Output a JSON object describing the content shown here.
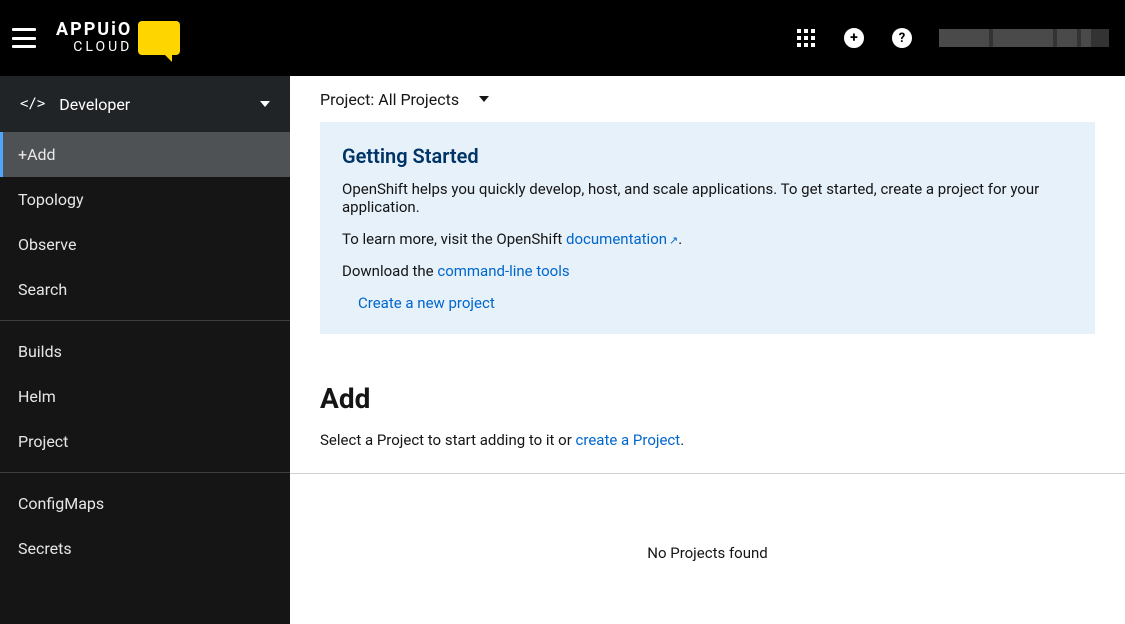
{
  "header": {
    "logo_top": "APPUiO",
    "logo_bottom": "CLOUD"
  },
  "sidebar": {
    "perspective": "Developer",
    "groups": [
      {
        "items": [
          {
            "label": "+Add",
            "active": true
          },
          {
            "label": "Topology"
          },
          {
            "label": "Observe"
          },
          {
            "label": "Search"
          }
        ]
      },
      {
        "items": [
          {
            "label": "Builds"
          },
          {
            "label": "Helm"
          },
          {
            "label": "Project"
          }
        ]
      },
      {
        "items": [
          {
            "label": "ConfigMaps"
          },
          {
            "label": "Secrets"
          }
        ]
      }
    ]
  },
  "project_bar": {
    "label": "Project: All Projects"
  },
  "getting_started": {
    "title": "Getting Started",
    "intro": "OpenShift helps you quickly develop, host, and scale applications. To get started, create a project for your application.",
    "learn_prefix": "To learn more, visit the OpenShift ",
    "doc_link": "documentation",
    "learn_suffix": ".",
    "download_prefix": "Download the ",
    "cli_link": "command-line tools",
    "create_link": "Create a new project"
  },
  "add_section": {
    "title": "Add",
    "sub_prefix": "Select a Project to start adding to it or ",
    "sub_link": "create a Project",
    "sub_suffix": "."
  },
  "empty_state": "No Projects found"
}
